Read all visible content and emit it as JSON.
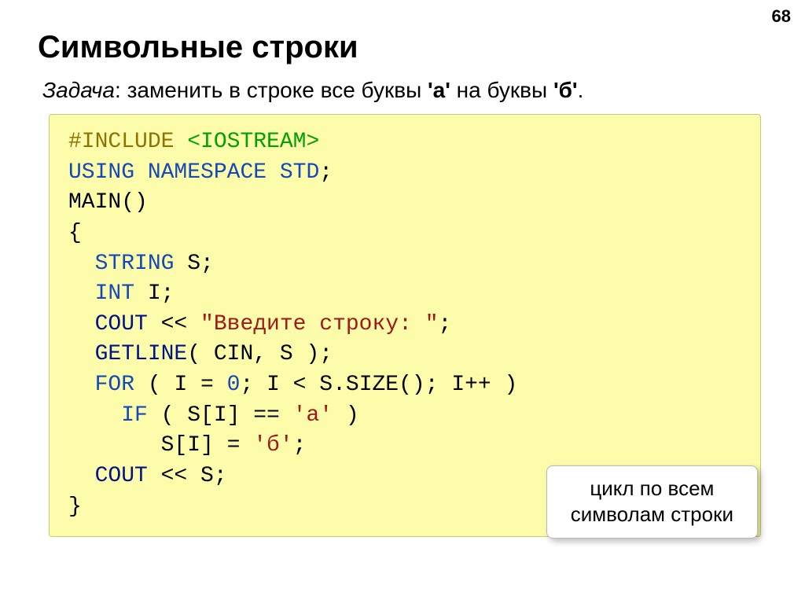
{
  "page_number": "68",
  "title": "Символьные строки",
  "task": {
    "label": "Задача",
    "colon": ": ",
    "text_before_a": "заменить в строке все буквы ",
    "letter_a": "'а'",
    "text_between": " на буквы ",
    "letter_b": "'б'",
    "period": "."
  },
  "code": {
    "l1": {
      "include": "#INCLUDE",
      "iostream": "<IOSTREAM>"
    },
    "l2": {
      "using": "USING",
      "namespace": "NAMESPACE",
      "std": "STD",
      "semi": ";"
    },
    "l3": "MAIN()",
    "l4": "{",
    "l5": {
      "string": "STRING",
      "rest": " S;"
    },
    "l6": {
      "int": "INT",
      "rest": " I;"
    },
    "l7": {
      "cout": "COUT",
      "op": " << ",
      "str": "\"Введите строку: \"",
      "semi": ";"
    },
    "l8": {
      "getline": "GETLINE",
      "rest": "( CIN, S );"
    },
    "l9": {
      "for": "FOR",
      "a": " ( I = ",
      "zero": "0",
      "b": "; I < S.SIZE(); I++ )"
    },
    "l10": {
      "if": "IF",
      "a": " ( S[I] == ",
      "ch": "'а'",
      "b": " )"
    },
    "l11": {
      "a": "S[I] = ",
      "ch": "'б'",
      "b": ";"
    },
    "l12": {
      "cout": "COUT",
      "rest": " << S;"
    },
    "l13": "}"
  },
  "annotation": {
    "line1": "цикл по всем",
    "line2": "символам строки"
  }
}
